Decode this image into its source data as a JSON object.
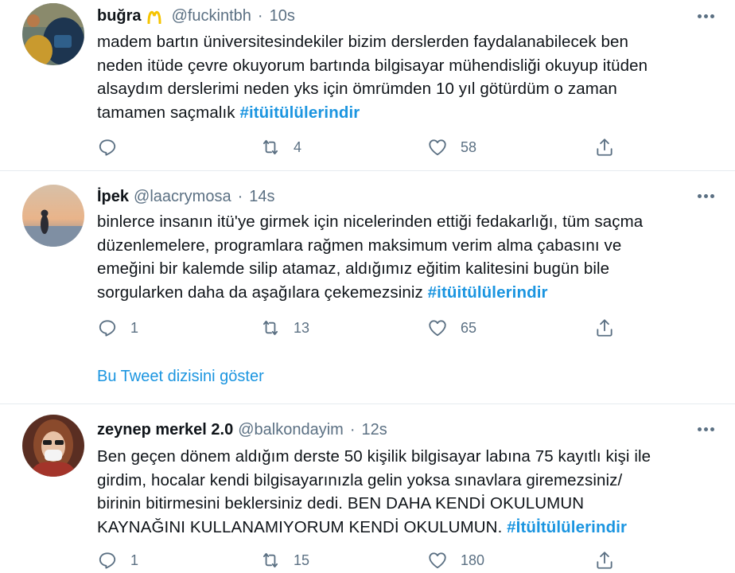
{
  "tweets": [
    {
      "name": "buğra",
      "handle": "@fuckintbh",
      "sep": "·",
      "time": "10s",
      "lines": [
        "madem bartın üniversitesindekiler bizim derslerden faydalanabilecek ben",
        "neden itüde çevre okuyorum bartında bilgisayar mühendisliği okuyup itüden",
        "alsaydım derslerimi neden yks için ömrümden 10 yıl götürdüm o zaman",
        "tamamen saçmalık "
      ],
      "hashtag": "#itüitülülerindir",
      "replies": "",
      "retweets": "4",
      "likes": "58"
    },
    {
      "name": "İpek",
      "handle": "@laacrymosa",
      "sep": "·",
      "time": "14s",
      "lines": [
        "binlerce insanın itü'ye girmek için nicelerinden ettiği fedakarlığı, tüm saçma",
        "düzenlemelere, programlara rağmen maksimum verim alma çabasını ve",
        "emeğini bir kalemde silip atamaz, aldığımız eğitim kalitesini bugün bile",
        "sorgularken daha da aşağılara çekemezsiniz "
      ],
      "hashtag": "#itüitülülerindir",
      "replies": "1",
      "retweets": "13",
      "likes": "65"
    },
    {
      "name": "zeynep merkel 2.0",
      "handle": "@balkondayim",
      "sep": "·",
      "time": "12s",
      "lines": [
        "Ben geçen dönem aldığım derste 50 kişilik bilgisayar labına 75 kayıtlı kişi ile",
        "girdim, hocalar kendi bilgisayarınızla gelin yoksa sınavlara giremezsiniz/",
        "birinin bitirmesini beklersiniz dedi. BEN DAHA KENDİ OKULUMUN",
        "KAYNAĞINI KULLANAMIYORUM KENDİ OKULUMUN. "
      ],
      "hashtag": "#İtüİtülülerindir",
      "replies": "1",
      "retweets": "15",
      "likes": "180"
    }
  ],
  "thread_link": "Bu Tweet dizisini göster",
  "icons": {
    "more": "more-icon",
    "reply": "reply-icon",
    "retweet": "retweet-icon",
    "like": "heart-icon",
    "share": "share-icon",
    "badge": "golden-arches-emoji"
  },
  "colors": {
    "hashtag": "#1b95e0",
    "secondary_text": "#5b7083",
    "divider": "#e6ecf0",
    "badge": "#f5c400"
  }
}
